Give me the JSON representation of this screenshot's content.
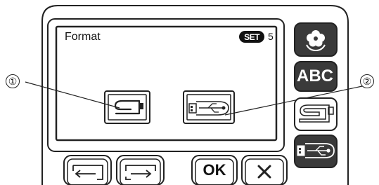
{
  "screen": {
    "title": "Format",
    "set_badge": "SET",
    "set_number": "5"
  },
  "callouts": {
    "one": "①",
    "two": "②"
  },
  "side_buttons": {
    "abc_label": "ABC",
    "flower_icon": "flower-icon",
    "machine_icon": "sewing-machine-icon",
    "usb_icon": "usb-drive-icon"
  },
  "bottom_buttons": {
    "ok_label": "OK",
    "close_symbol": "✕"
  },
  "colors": {
    "panel_bg": "#ffffff",
    "outline": "#222222",
    "dark_button": "#3a3a3a"
  }
}
